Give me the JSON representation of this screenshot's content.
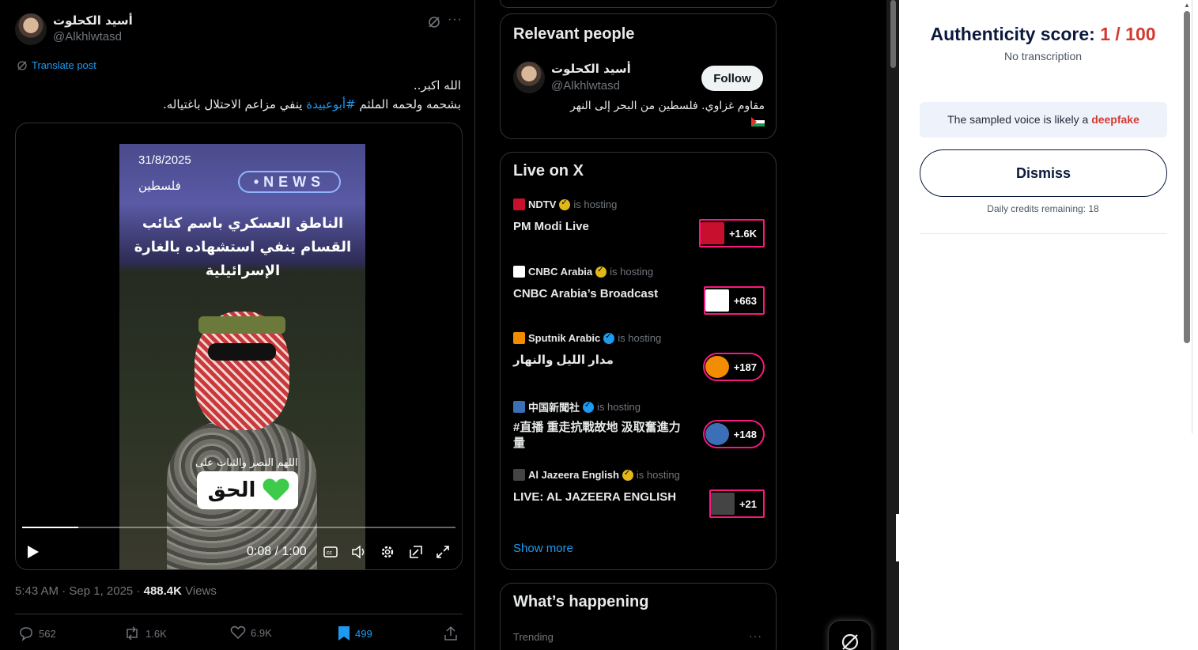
{
  "tweet": {
    "author_name": "أسيد الكحلوت",
    "author_handle": "@Alkhlwtasd",
    "translate_label": "Translate post",
    "text_line1": "الله اكبر..",
    "text_line2_pre": "بشحمه ولحمه الملثم ",
    "text_hashtag": "#أبوعبيدة",
    "text_line2_post": " ينفي مزاعم الاحتلال باغتياله.",
    "video": {
      "date": "31/8/2025",
      "news_label": "•NEWS",
      "place": "فلسطين",
      "headline": "الناطق العسكري باسم كتائب القسام ينفي استشهاده بالغارة الإسرائيلية",
      "caption": "اللهم النصر والثبات على",
      "sticker_text": "الحق",
      "time": "0:08 / 1:00",
      "progress": 0.13
    },
    "timestamp": "5:43 AM · Sep 1, 2025 · ",
    "views_count": "488.4K",
    "views_label": " Views",
    "replies": "562",
    "reposts": "1.6K",
    "likes": "6.9K",
    "bookmarks": "499"
  },
  "relevant_people": {
    "title": "Relevant people",
    "name": "أسيد الكحلوت",
    "handle": "@Alkhlwtasd",
    "follow_label": "Follow",
    "bio": "مقاوم غزاوي. فلسطين من البحر إلى النهر"
  },
  "live": {
    "title": "Live on X",
    "hosting_label": "is hosting",
    "items": [
      {
        "host": "NDTV",
        "verified": "gold",
        "title": "PM Modi Live",
        "count": "+1.6K",
        "logo_color": "#c8102e",
        "badge": "square"
      },
      {
        "host": "CNBC Arabia",
        "verified": "gold",
        "title": "CNBC Arabia’s Broadcast",
        "count": "+663",
        "logo_color": "#ffffff",
        "badge": "square"
      },
      {
        "host": "Sputnik Arabic",
        "verified": "blue",
        "title": "مدار الليل والنهار",
        "count": "+187",
        "logo_color": "#f28c00",
        "badge": "pill"
      },
      {
        "host": "中国新聞社",
        "verified": "blue",
        "title": "#直播 重走抗戰故地 汲取奮進力量",
        "count": "+148",
        "logo_color": "#3b6fb6",
        "badge": "pill"
      },
      {
        "host": "Al Jazeera English",
        "verified": "gold",
        "title": "LIVE: AL JAZEERA ENGLISH",
        "count": "+21",
        "logo_color": "#444444",
        "badge": "square"
      }
    ],
    "show_more": "Show more"
  },
  "whats_happening": {
    "title": "What’s happening",
    "trending_label": "Trending"
  },
  "extension": {
    "score_label": "Authenticity score: ",
    "score_value": "1 / 100",
    "no_transcription": "No transcription",
    "verdict_pre": "The sampled voice is likely a ",
    "verdict_word": "deepfake",
    "dismiss_label": "Dismiss",
    "credits": "Daily credits remaining: 18",
    "accent_color": "#d23b33"
  }
}
